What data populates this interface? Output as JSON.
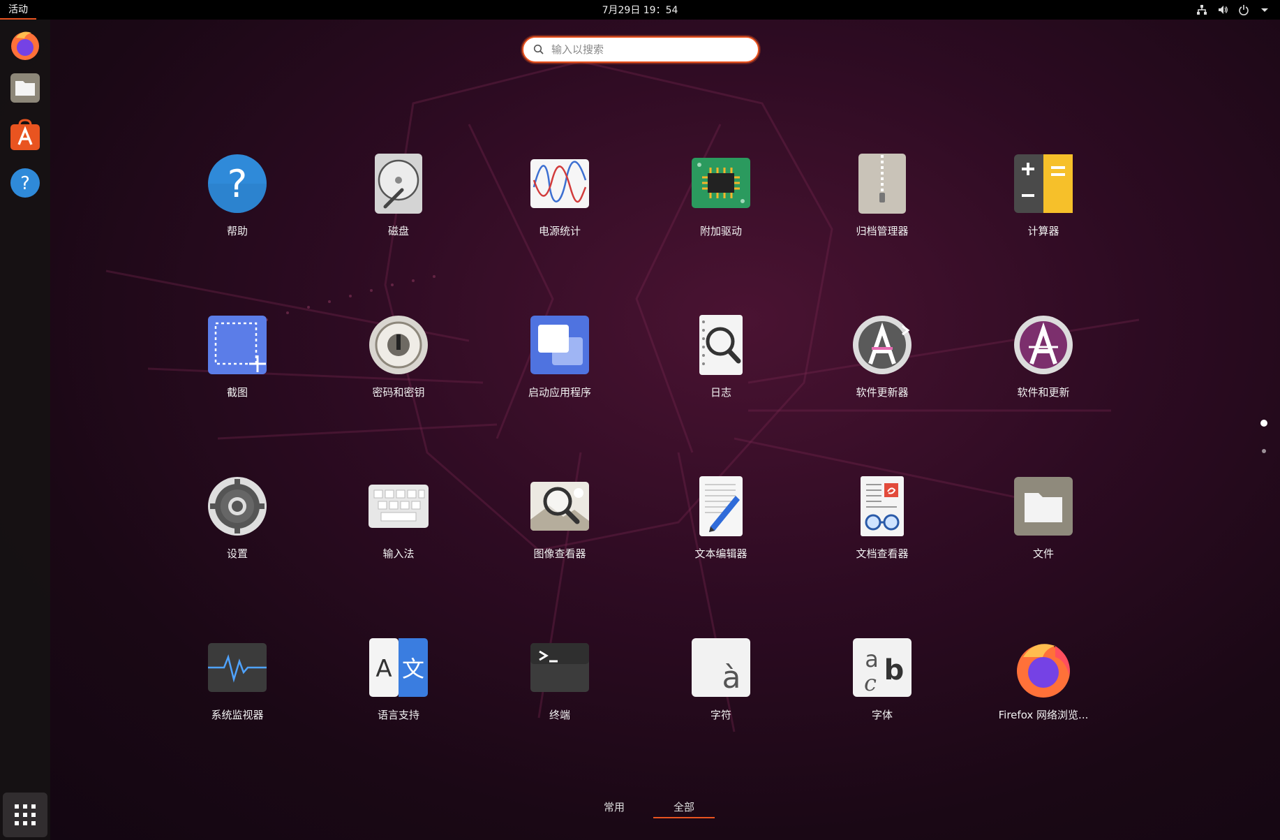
{
  "topbar": {
    "activities": "活动",
    "clock": "7月29日 19：54",
    "tray": [
      "network-icon",
      "volume-icon",
      "power-icon",
      "dropdown-arrow-icon"
    ]
  },
  "dock": {
    "items": [
      {
        "name": "firefox",
        "icon": "firefox-icon"
      },
      {
        "name": "files",
        "icon": "files-icon"
      },
      {
        "name": "software",
        "icon": "software-store-icon"
      },
      {
        "name": "help",
        "icon": "help-icon"
      }
    ],
    "show_apps": "grid-icon"
  },
  "search": {
    "placeholder": "输入以搜索",
    "value": ""
  },
  "apps": [
    {
      "label": "帮助",
      "icon": "help-icon"
    },
    {
      "label": "磁盘",
      "icon": "disk-icon"
    },
    {
      "label": "电源统计",
      "icon": "power-stats-icon"
    },
    {
      "label": "附加驱动",
      "icon": "chip-icon"
    },
    {
      "label": "归档管理器",
      "icon": "archive-icon"
    },
    {
      "label": "计算器",
      "icon": "calculator-icon"
    },
    {
      "label": "截图",
      "icon": "screenshot-icon"
    },
    {
      "label": "密码和密钥",
      "icon": "keyring-icon"
    },
    {
      "label": "启动应用程序",
      "icon": "startup-apps-icon"
    },
    {
      "label": "日志",
      "icon": "logs-icon"
    },
    {
      "label": "软件更新器",
      "icon": "software-updater-icon"
    },
    {
      "label": "软件和更新",
      "icon": "software-properties-icon"
    },
    {
      "label": "设置",
      "icon": "gear-icon"
    },
    {
      "label": "输入法",
      "icon": "keyboard-icon"
    },
    {
      "label": "图像查看器",
      "icon": "image-viewer-icon"
    },
    {
      "label": "文本编辑器",
      "icon": "text-editor-icon"
    },
    {
      "label": "文档查看器",
      "icon": "document-viewer-icon"
    },
    {
      "label": "文件",
      "icon": "files-icon"
    },
    {
      "label": "系统监视器",
      "icon": "system-monitor-icon"
    },
    {
      "label": "语言支持",
      "icon": "language-icon"
    },
    {
      "label": "终端",
      "icon": "terminal-icon"
    },
    {
      "label": "字符",
      "icon": "characters-icon"
    },
    {
      "label": "字体",
      "icon": "fonts-icon"
    },
    {
      "label": "Firefox 网络浏览...",
      "icon": "firefox-icon"
    }
  ],
  "pages": {
    "count": 2,
    "current": 1
  },
  "tabs": [
    {
      "label": "常用",
      "active": false
    },
    {
      "label": "全部",
      "active": true
    }
  ],
  "colors": {
    "accent": "#e95420"
  }
}
